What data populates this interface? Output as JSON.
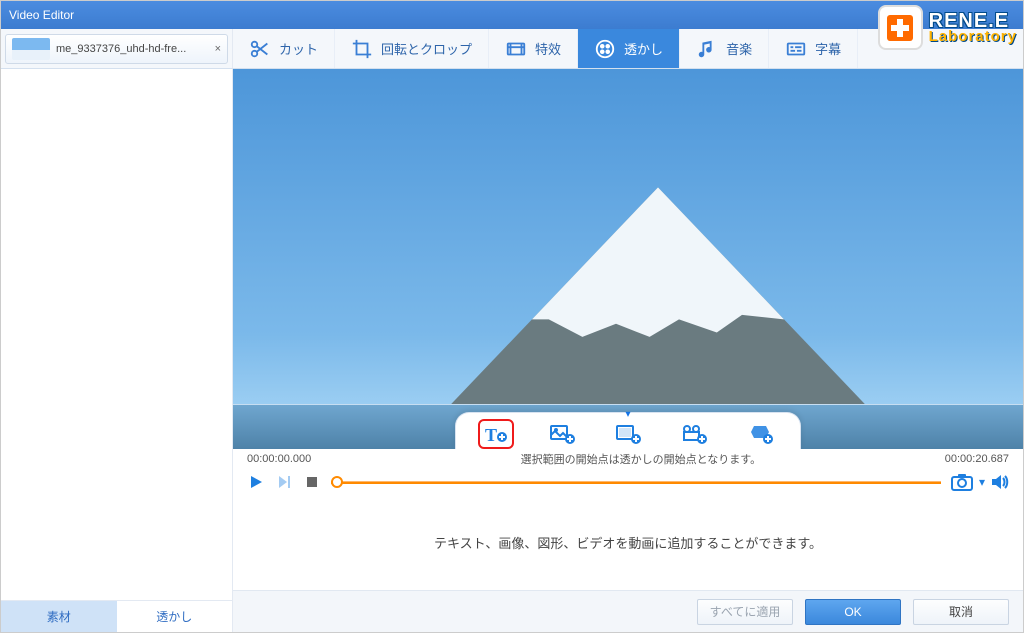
{
  "titlebar": {
    "title": "Video Editor"
  },
  "logo": {
    "line1": "RENE.E",
    "line2": "Laboratory"
  },
  "file": {
    "name": "me_9337376_uhd-hd-fre..."
  },
  "toolbar": {
    "cut": "カット",
    "rotate": "回転とクロップ",
    "fx": "特效",
    "watermark": "透かし",
    "music": "音楽",
    "subtitle": "字幕"
  },
  "side": {
    "materials": "素材",
    "watermark": "透かし"
  },
  "time": {
    "start": "00:00:00.000",
    "end": "00:00:20.687",
    "hint": "選択範囲の開始点は透かしの開始点となります。"
  },
  "description": "テキスト、画像、図形、ビデオを動画に追加することができます。",
  "footer": {
    "applyAll": "すべてに適用",
    "ok": "OK",
    "cancel": "取消"
  }
}
